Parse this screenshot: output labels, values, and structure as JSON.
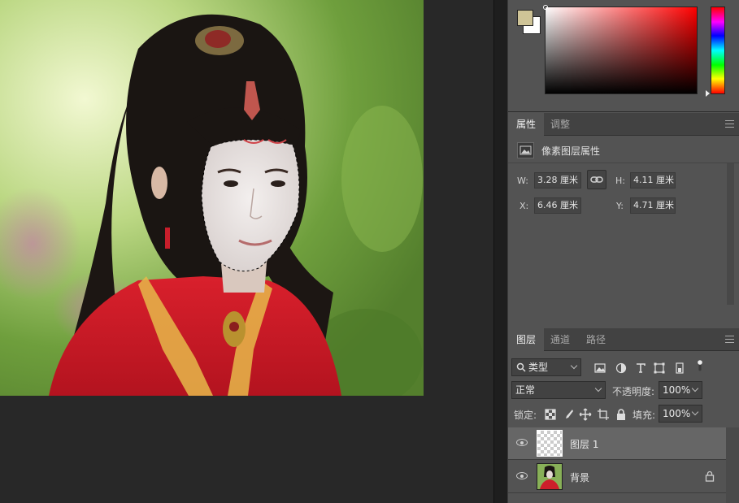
{
  "color_panel": {
    "foreground_color": "#cfc497",
    "background_color": "#ffffff"
  },
  "properties_panel": {
    "tabs": [
      "属性",
      "调整"
    ],
    "active_tab": "属性",
    "section_title": "像素图层属性",
    "w_label": "W:",
    "w_value": "3.28 厘米",
    "h_label": "H:",
    "h_value": "4.11 厘米",
    "x_label": "X:",
    "x_value": "6.46 厘米",
    "y_label": "Y:",
    "y_value": "4.71 厘米",
    "link_icon": "chain-link-icon"
  },
  "layers_panel": {
    "tabs": [
      "图层",
      "通道",
      "路径"
    ],
    "active_tab": "图层",
    "filter_kind": "类型",
    "blend_mode": "正常",
    "opacity_label": "不透明度:",
    "opacity_value": "100%",
    "lock_label": "锁定:",
    "fill_label": "填充:",
    "fill_value": "100%",
    "layers": [
      {
        "name": "图层 1",
        "visible": true,
        "selected": true,
        "locked": false,
        "thumbnail": "transparent-checker"
      },
      {
        "name": "背景",
        "visible": true,
        "selected": false,
        "locked": true,
        "thumbnail": "photo"
      }
    ]
  }
}
